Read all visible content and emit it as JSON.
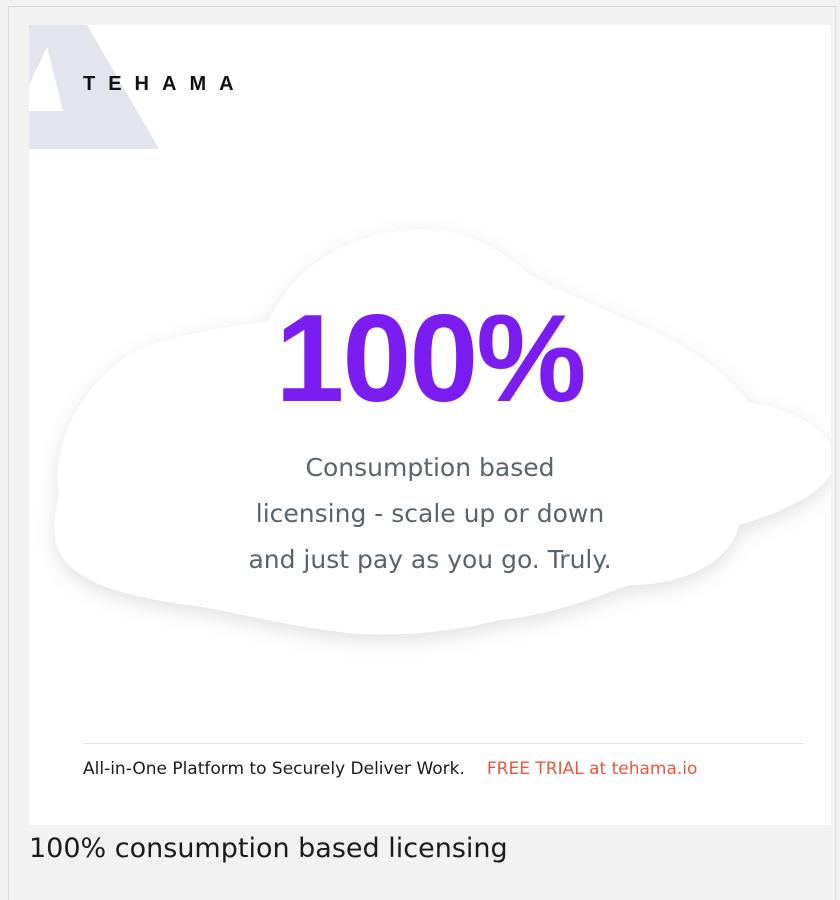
{
  "ad": {
    "brand": "TEHAMA",
    "headline": "100%",
    "description_lines": [
      "Consumption based",
      "licensing - scale up or down",
      "and just pay as you go. Truly."
    ],
    "footer_tagline": "All-in-One Platform to Securely Deliver Work.",
    "footer_cta": "FREE TRIAL at tehama.io",
    "colors": {
      "headline": "#7b1df0",
      "cta": "#e8563f",
      "body_text": "#59636b",
      "logo_accent": "#e3e5ee"
    }
  },
  "caption": "100% consumption based licensing"
}
